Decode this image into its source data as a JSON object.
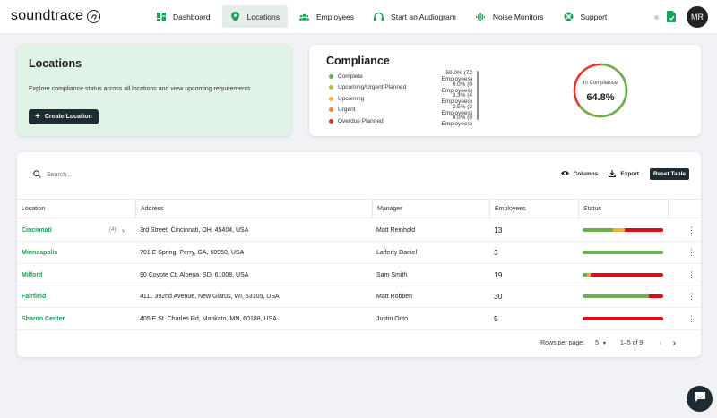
{
  "app": {
    "brand": "soundtrace",
    "avatar_initials": "MR"
  },
  "nav": {
    "items": [
      {
        "label": "Dashboard",
        "icon": "grid-icon"
      },
      {
        "label": "Locations",
        "icon": "map-pin-icon",
        "active": true
      },
      {
        "label": "Employees",
        "icon": "users-icon"
      },
      {
        "label": "Start an Audiogram",
        "icon": "headphones-icon"
      },
      {
        "label": "Noise Monitors",
        "icon": "waveform-icon"
      },
      {
        "label": "Support",
        "icon": "lifebuoy-icon"
      }
    ]
  },
  "locations_card": {
    "title": "Locations",
    "description": "Explore compliance status across all locations and view upcoming requirements",
    "create_button": "Create Location"
  },
  "compliance": {
    "title": "Compliance",
    "legend": [
      {
        "label": "Complete",
        "value": "59.0% (72 Employees)",
        "color": "#6ab04c"
      },
      {
        "label": "Upcoming/Urgent Planned",
        "value": "0.0% (0 Employees)",
        "color": "#a6c849"
      },
      {
        "label": "Upcoming",
        "value": "3.3% (4 Employees)",
        "color": "#f0b43c"
      },
      {
        "label": "Urgent",
        "value": "2.5% (3 Employees)",
        "color": "#ec8a3a"
      },
      {
        "label": "Overdue Planned",
        "value": "0.0% (0 Employees)",
        "color": "#e03a2f"
      }
    ],
    "donut_label": "In Compliance",
    "donut_value": "64.8%",
    "donut_fraction": 0.648
  },
  "table": {
    "search_placeholder": "Search...",
    "columns_label": "Columns",
    "export_label": "Export",
    "reset_label": "Reset Table",
    "headers": [
      "Location",
      "Address",
      "Manager",
      "Employees",
      "Status"
    ],
    "rows": [
      {
        "location": "Cincinnati",
        "count": "(4)",
        "address": "3rd Street, Cincinnati, OH, 45404, USA",
        "manager": "Matt Reinhold",
        "employees": "13",
        "status": [
          {
            "color": "#6ab04c",
            "frac": 0.38
          },
          {
            "color": "#f0b43c",
            "frac": 0.14
          },
          {
            "color": "#e8e8e8",
            "frac": 0.0
          },
          {
            "color": "#e30b13",
            "frac": 0.48
          }
        ]
      },
      {
        "location": "Minneapolis",
        "count": "",
        "address": "701 E Spring, Perry, GA, 60950, USA",
        "manager": "Lafferty Daniel",
        "employees": "3",
        "status": [
          {
            "color": "#6ab04c",
            "frac": 1.0
          }
        ]
      },
      {
        "location": "Milford",
        "count": "",
        "address": "90 Coyote Ct, Alpena, SD, 61008, USA",
        "manager": "Sam Smith",
        "employees": "19",
        "status": [
          {
            "color": "#6ab04c",
            "frac": 0.05
          },
          {
            "color": "#f0b43c",
            "frac": 0.05
          },
          {
            "color": "#e30b13",
            "frac": 0.9
          }
        ]
      },
      {
        "location": "Fairfield",
        "count": "",
        "address": "4111 392nd Avenue, New Glarus, WI, 53105, USA",
        "manager": "Matt Robben",
        "employees": "30",
        "status": [
          {
            "color": "#6ab04c",
            "frac": 0.82
          },
          {
            "color": "#e30b13",
            "frac": 0.18
          }
        ]
      },
      {
        "location": "Sharon Center",
        "count": "",
        "address": "405 E St. Charles Rd, Mankato, MN, 60188, USA",
        "manager": "Justin Octo",
        "employees": "5",
        "status": [
          {
            "color": "#e30b13",
            "frac": 1.0
          }
        ]
      }
    ],
    "rows_per_page_label": "Rows per page:",
    "rows_per_page": "5",
    "page_range": "1–5 of 9"
  }
}
